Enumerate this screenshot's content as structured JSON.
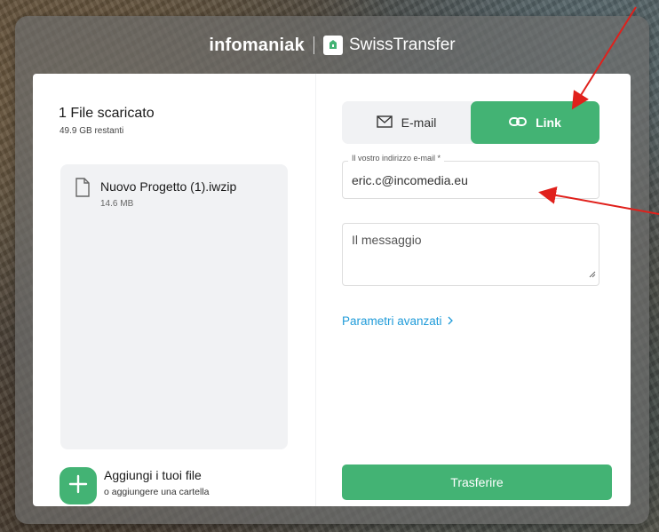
{
  "header": {
    "brand_infomaniak": "infomaniak",
    "brand_swisstransfer": "SwissTransfer"
  },
  "files": {
    "title": "1 File scaricato",
    "remaining": "49.9 GB restanti",
    "items": [
      {
        "name": "Nuovo Progetto (1).iwzip",
        "size": "14.6 MB"
      }
    ]
  },
  "add_files": {
    "title": "Aggiungi i tuoi file",
    "subtitle": "o aggiungere una cartella"
  },
  "tabs": [
    {
      "label": "E-mail",
      "icon": "envelope-icon",
      "active": false
    },
    {
      "label": "Link",
      "icon": "link-icon",
      "active": true
    }
  ],
  "form": {
    "email_label": "Il vostro indirizzo e-mail *",
    "email_value": "eric.c@incomedia.eu",
    "message_placeholder": "Il messaggio",
    "advanced_label": "Parametri avanzati"
  },
  "actions": {
    "transfer_label": "Trasferire"
  },
  "colors": {
    "accent": "#43b374",
    "link": "#1f9bd9",
    "annotation": "#e0201b"
  }
}
